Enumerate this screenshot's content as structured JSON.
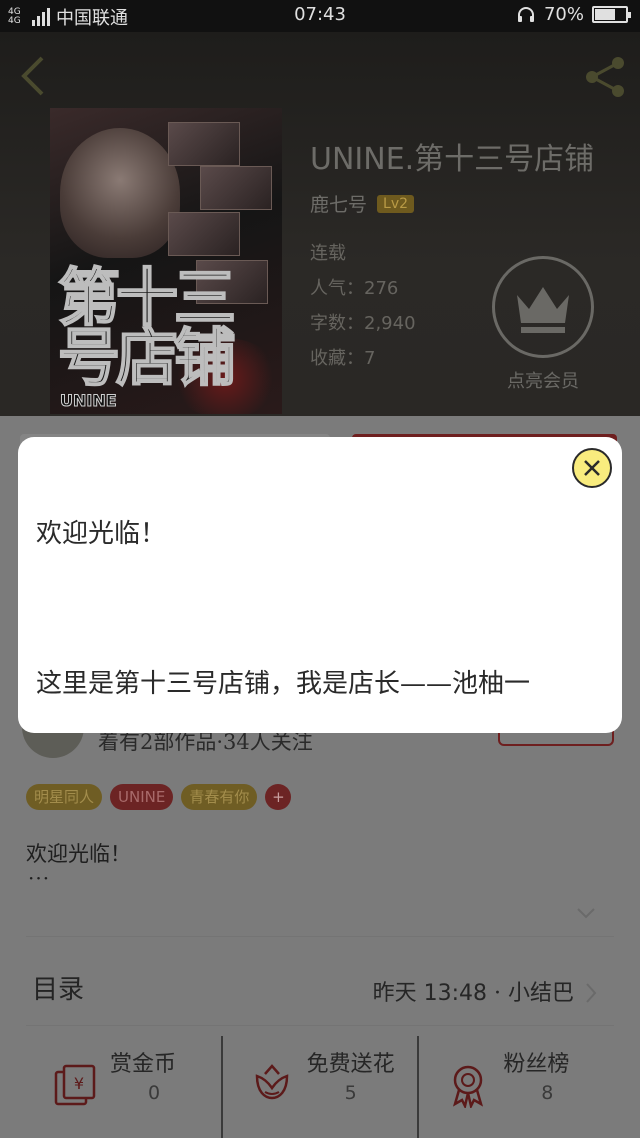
{
  "status_bar": {
    "network": "4G 4G",
    "carrier": "中国联通",
    "time": "07:43",
    "battery_text": "70%",
    "battery_level": 0.7
  },
  "book": {
    "title": "UNINE.第十三号店铺",
    "author": "鹿七号",
    "author_level": "Lv2",
    "status": "连载",
    "popularity_label": "人气：",
    "popularity_value": "276",
    "word_count_label": "字数：",
    "word_count_value": "2,940",
    "favorites_label": "收藏：",
    "favorites_value": "7",
    "vip_label": "点亮会员",
    "cover_title_art": "第十三号店铺",
    "cover_tag_art": "UNINE"
  },
  "author_info": {
    "works_text": "着有2部作品·34人关注"
  },
  "tags": [
    "明星同人",
    "UNINE",
    "青春有你",
    "+"
  ],
  "intro": {
    "text": "欢迎光临！",
    "ellipsis": "···"
  },
  "toc": {
    "label": "目录",
    "latest_prefix": "昨天 ",
    "latest_time": "13:48",
    "latest_suffix": " · 小结巴"
  },
  "actions": [
    {
      "label": "赏金币",
      "count": "0",
      "icon": "coin-envelope-icon"
    },
    {
      "label": "免费送花",
      "count": "5",
      "icon": "flower-icon"
    },
    {
      "label": "粉丝榜",
      "count": "8",
      "icon": "ribbon-icon"
    }
  ],
  "modal": {
    "line1": "欢迎光临！",
    "line2": "这里是第十三号店铺，我是店长——池柚一"
  },
  "colors": {
    "modal_close_bg": "#f9ec7e",
    "accent_red": "#6e1f1f",
    "accent_gold": "#b89a45"
  }
}
